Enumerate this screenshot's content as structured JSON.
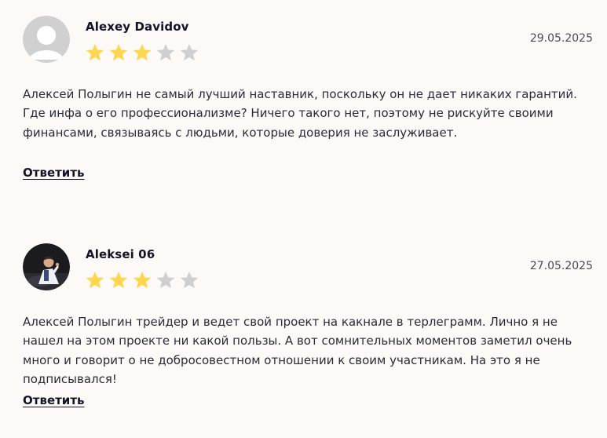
{
  "reviews": [
    {
      "author": "Alexey Davidov",
      "date": "29.05.2025",
      "rating": 3,
      "max_rating": 5,
      "text": "Алексей Полыгин не самый лучший наставник, поскольку он не дает никаких гарантий. Где инфа о его профессионализме? Ничего такого нет, поэтому не рискуйте своими финансами, связываясь с людьми, которые доверия не заслуживает.",
      "reply_label": "Ответить"
    },
    {
      "author": "Aleksei 06",
      "date": "27.05.2025",
      "rating": 3,
      "max_rating": 5,
      "text": "Алексей Полыгин трейдер и ведет свой проект на какнале в терлеграмм. Лично я не нашел на этом проекте ни какой пользы. А вот сомнительных моментов заметил очень много и говорит о не добросовестном отношении к своим участникам. На это я не подписывался!",
      "reply_label": "Ответить"
    }
  ],
  "colors": {
    "background": "#fdf9f6",
    "star_filled": "#ffd64f",
    "star_empty": "#cfcfcf",
    "text": "#2b2b36",
    "author": "#141427"
  },
  "icons": {
    "avatar_placeholder": "user-silhouette-icon",
    "avatar_photo": "user-photo",
    "star": "star-icon"
  }
}
